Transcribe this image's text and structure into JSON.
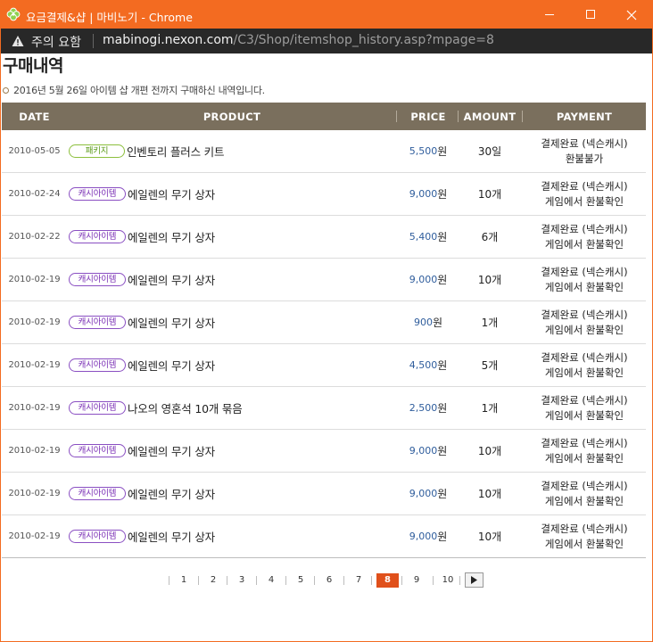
{
  "window": {
    "title": "요금결제&샵 | 마비노기 - Chrome",
    "accent": "#f36b21"
  },
  "addressbar": {
    "warning": "주의 요함",
    "url_host": "mabinogi.nexon.com",
    "url_path": "/C3/Shop/itemshop_history.asp?mpage=8"
  },
  "page": {
    "title": "구매내역",
    "notice": "2016년 5월 26일 아이템 샵 개편 전까지 구매하신 내역입니다."
  },
  "table": {
    "headers": {
      "date": "DATE",
      "product": "PRODUCT",
      "price": "PRICE",
      "amount": "AMOUNT",
      "payment": "PAYMENT"
    },
    "rows": [
      {
        "date": "2010-05-05",
        "badge": "패키지",
        "badge_type": "pkg",
        "product": "인벤토리 플러스 키트",
        "price": "5,500",
        "won": "원",
        "amount": "30일",
        "pay1": "결제완료 (넥슨캐시)",
        "pay2": "환불불가"
      },
      {
        "date": "2010-02-24",
        "badge": "캐시아이템",
        "badge_type": "cash",
        "product": "에일렌의 무기 상자",
        "price": "9,000",
        "won": "원",
        "amount": "10개",
        "pay1": "결제완료 (넥슨캐시)",
        "pay2": "게임에서 환불확인"
      },
      {
        "date": "2010-02-22",
        "badge": "캐시아이템",
        "badge_type": "cash",
        "product": "에일렌의 무기 상자",
        "price": "5,400",
        "won": "원",
        "amount": "6개",
        "pay1": "결제완료 (넥슨캐시)",
        "pay2": "게임에서 환불확인"
      },
      {
        "date": "2010-02-19",
        "badge": "캐시아이템",
        "badge_type": "cash",
        "product": "에일렌의 무기 상자",
        "price": "9,000",
        "won": "원",
        "amount": "10개",
        "pay1": "결제완료 (넥슨캐시)",
        "pay2": "게임에서 환불확인"
      },
      {
        "date": "2010-02-19",
        "badge": "캐시아이템",
        "badge_type": "cash",
        "product": "에일렌의 무기 상자",
        "price": "900",
        "won": "원",
        "amount": "1개",
        "pay1": "결제완료 (넥슨캐시)",
        "pay2": "게임에서 환불확인"
      },
      {
        "date": "2010-02-19",
        "badge": "캐시아이템",
        "badge_type": "cash",
        "product": "에일렌의 무기 상자",
        "price": "4,500",
        "won": "원",
        "amount": "5개",
        "pay1": "결제완료 (넥슨캐시)",
        "pay2": "게임에서 환불확인"
      },
      {
        "date": "2010-02-19",
        "badge": "캐시아이템",
        "badge_type": "cash",
        "product": "나오의 영혼석 10개 묶음",
        "price": "2,500",
        "won": "원",
        "amount": "1개",
        "pay1": "결제완료 (넥슨캐시)",
        "pay2": "게임에서 환불확인"
      },
      {
        "date": "2010-02-19",
        "badge": "캐시아이템",
        "badge_type": "cash",
        "product": "에일렌의 무기 상자",
        "price": "9,000",
        "won": "원",
        "amount": "10개",
        "pay1": "결제완료 (넥슨캐시)",
        "pay2": "게임에서 환불확인"
      },
      {
        "date": "2010-02-19",
        "badge": "캐시아이템",
        "badge_type": "cash",
        "product": "에일렌의 무기 상자",
        "price": "9,000",
        "won": "원",
        "amount": "10개",
        "pay1": "결제완료 (넥슨캐시)",
        "pay2": "게임에서 환불확인"
      },
      {
        "date": "2010-02-19",
        "badge": "캐시아이템",
        "badge_type": "cash",
        "product": "에일렌의 무기 상자",
        "price": "9,000",
        "won": "원",
        "amount": "10개",
        "pay1": "결제완료 (넥슨캐시)",
        "pay2": "게임에서 환불확인"
      }
    ]
  },
  "pager": {
    "pages": [
      "1",
      "2",
      "3",
      "4",
      "5",
      "6",
      "7",
      "8",
      "9",
      "10"
    ],
    "current": "8",
    "next_icon": "play-triangle-icon"
  },
  "colors": {
    "header_bg": "#7a6f5d",
    "price_blue": "#2f5d9c",
    "pkg_green": "#8cbf3d",
    "cash_purple": "#8a4fc2",
    "active_page": "#e0501b"
  }
}
